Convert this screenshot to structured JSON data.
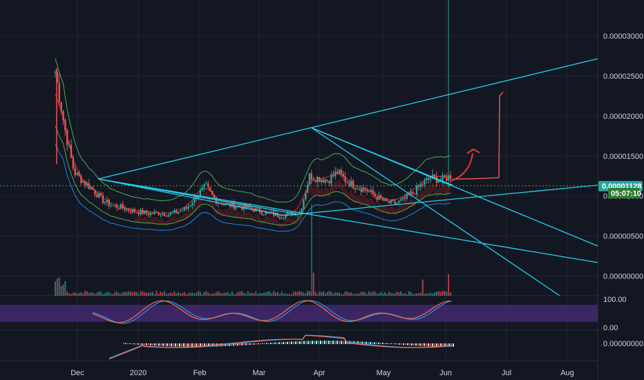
{
  "theme": {
    "background": "#131722",
    "grid": "#1f2432",
    "axis_text": "#d1d4dc",
    "up": "#26a69a",
    "down": "#ef5350",
    "trendline": "#22d3ee",
    "bb_line": "#4caf50",
    "ma_red": "#c62828",
    "cloud": "#7b1f1f",
    "price_badge": "#26a69a",
    "timer_badge": "#2e7d32",
    "rsi_band": "#4a2c7a",
    "stoch_blue": "#2196f3",
    "stoch_orange": "#ff7043",
    "arrow": "#e53935"
  },
  "badges": {
    "last_price": "0.00001128",
    "countdown": "05:07:10"
  },
  "chart_data": [
    {
      "type": "line",
      "panel": "price",
      "description_of_series": "candlestick price with bollinger bands and trendlines",
      "x": [
        "Dec",
        "2020",
        "Feb",
        "Mar",
        "Apr",
        "May",
        "Jun",
        "Jul",
        "Aug"
      ],
      "y_ticks": [
        "0.00003000",
        "0.00002500",
        "0.00002000",
        "0.00001500",
        "0.00001000",
        "0.00000500",
        "0.00000000"
      ],
      "ylim": [
        -2.2e-06,
        3.45e-05
      ],
      "last_value": 1.128e-05,
      "grid": true,
      "series": [
        {
          "values": [
            2.55e-05,
            1.85e-05,
            1.3e-05,
            1.18e-05,
            1.08e-05,
            9.5e-06,
            8.8e-06,
            8.6e-06,
            8.2e-06,
            8e-06,
            7.8e-06,
            7.9e-06,
            7.7e-06,
            8e-06,
            8.5e-06,
            1e-05,
            1.12e-05,
            9.5e-06,
            9e-06,
            8.8e-06,
            8.6e-06,
            8.4e-06,
            8e-06,
            7.8e-06,
            7.5e-06,
            7.8e-06,
            8e-06,
            1.25e-05,
            1.22e-05,
            1.2e-05,
            1.3e-05,
            1.18e-05,
            1.12e-05,
            1.08e-05,
            1e-05,
            9.3e-06,
            9e-06,
            9.5e-06,
            1.04e-05,
            1.15e-05,
            1.23e-05,
            1.2e-05,
            1.25e-05
          ]
        }
      ]
    },
    {
      "type": "bar",
      "panel": "volume",
      "x": [
        "Dec",
        "2020",
        "Feb",
        "Mar",
        "Apr",
        "May",
        "Jun",
        "Jul",
        "Aug"
      ]
    },
    {
      "type": "line",
      "panel": "stoch_rsi",
      "y_ticks": [
        "100.00",
        "0.00"
      ],
      "ylim": [
        0,
        100
      ],
      "band": [
        20,
        80
      ]
    },
    {
      "type": "line",
      "panel": "macd",
      "y_ticks": [
        "0.00000000"
      ]
    }
  ]
}
